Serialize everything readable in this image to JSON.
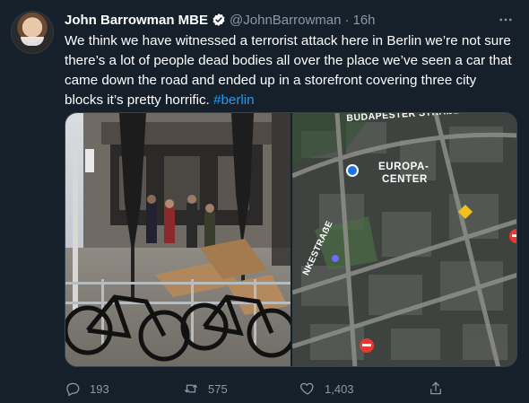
{
  "tweet": {
    "display_name": "John Barrowman MBE",
    "handle": "@JohnBarrowman",
    "separator": "·",
    "time": "16h",
    "text": "We think we have witnessed a terrorist attack here in Berlin we’re not sure there’s a lot of people dead bodies all over the place we’ve seen a car that came down the road and ended up in a storefront covering three city blocks it’s pretty horrific.",
    "hashtag": "#berlin"
  },
  "media": {
    "photo": {
      "description_icon": "street-scene-photo"
    },
    "map": {
      "labels": {
        "budapester": "BUDAPESTER STRAẞE",
        "europa_line1": "EUROPA-",
        "europa_line2": "CENTER",
        "street": "NKESTRAẞE"
      }
    }
  },
  "actions": {
    "reply_count": "193",
    "retweet_count": "575",
    "like_count": "1,403"
  },
  "colors": {
    "background": "#15202b",
    "text": "#ffffff",
    "muted": "#8b98a5",
    "link": "#1d9bf0"
  }
}
